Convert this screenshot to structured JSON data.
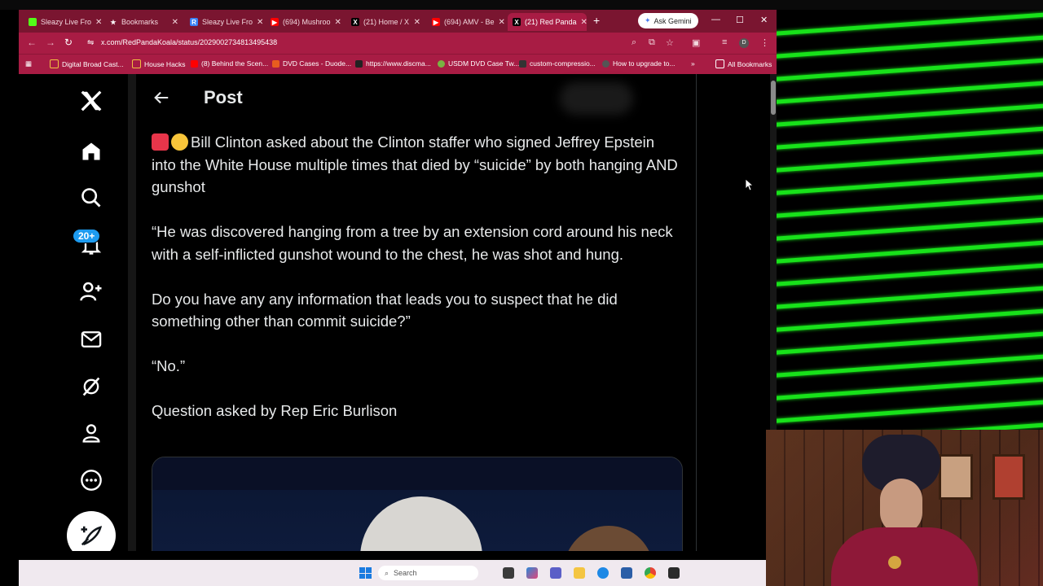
{
  "browser": {
    "tabs": [
      {
        "title": "Sleazy Live Fro",
        "favicon_color": "#53fc18",
        "favicon_glyph": ""
      },
      {
        "title": "Bookmarks",
        "favicon_color": "#7a1530",
        "favicon_glyph": "★"
      },
      {
        "title": "Sleazy Live Fro",
        "favicon_color": "#3b82f6",
        "favicon_glyph": "R"
      },
      {
        "title": "(694) Mushroo",
        "favicon_color": "#ff0000",
        "favicon_glyph": "▶"
      },
      {
        "title": "(21) Home / X",
        "favicon_color": "#000000",
        "favicon_glyph": "X"
      },
      {
        "title": "(694) AMV - Be",
        "favicon_color": "#ff0000",
        "favicon_glyph": "▶"
      },
      {
        "title": "(21) Red Panda",
        "favicon_color": "#000000",
        "favicon_glyph": "X"
      }
    ],
    "ask_gemini": "Ask Gemini",
    "url": "x.com/RedPandaKoala/status/2029002734813495438",
    "profile_initial": "D",
    "bookmarks": [
      {
        "label": "Digital Broad Cast...",
        "icon_color": "#f0c040"
      },
      {
        "label": "House Hacks",
        "icon_color": "#f0c040"
      },
      {
        "label": "(8) Behind the Scen...",
        "icon_color": "#ff0000"
      },
      {
        "label": "DVD Cases - Duode...",
        "icon_color": "#e85d1f"
      },
      {
        "label": "https://www.discma...",
        "icon_color": "#222222"
      },
      {
        "label": "USDM DVD Case Tw...",
        "icon_color": "#7ab342"
      },
      {
        "label": "custom-compressio...",
        "icon_color": "#333333"
      },
      {
        "label": "How to upgrade to...",
        "icon_color": "#555555"
      }
    ],
    "all_bookmarks": "All Bookmarks"
  },
  "x": {
    "notification_count": "20+",
    "post_title": "Post",
    "post_lead": "Bill Clinton asked about the Clinton staffer who signed Jeffrey Epstein into the White House multiple times that died by “suicide” by both hanging AND gunshot",
    "quote1": "“He was discovered hanging from a tree by an extension cord around his neck with a self-inflicted gunshot wound to the chest, he was shot and hung.",
    "quote2": "Do you have any any information that leads you to suspect that he did something other than commit suicide?”",
    "quote3": "“No.”",
    "credit": "Question asked by Rep Eric Burlison"
  },
  "taskbar": {
    "search_placeholder": "Search"
  },
  "colors": {
    "tabstrip": "#7a1530",
    "toolbar": "#a81c44",
    "x_blue": "#1d9bf0",
    "neon_green": "#18e21a"
  }
}
